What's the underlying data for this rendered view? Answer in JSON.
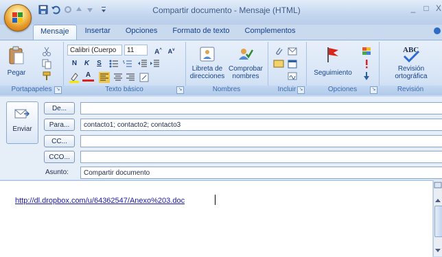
{
  "window": {
    "title": "Compartir documento - Mensaje (HTML)",
    "minimize_glyph": "_",
    "maximize_glyph": "□",
    "close_glyph": "X"
  },
  "tabs": [
    {
      "label": "Mensaje",
      "active": true
    },
    {
      "label": "Insertar"
    },
    {
      "label": "Opciones"
    },
    {
      "label": "Formato de texto"
    },
    {
      "label": "Complementos"
    }
  ],
  "ribbon": {
    "portapapeles": {
      "label": "Portapapeles",
      "paste": "Pegar"
    },
    "texto_basico": {
      "label": "Texto básico",
      "font": "Calibri (Cuerpo",
      "size": "11",
      "bold": "N",
      "italic": "K",
      "underline": "S"
    },
    "nombres": {
      "label": "Nombres",
      "address_book": "Libreta de direcciones",
      "check_names": "Comprobar nombres"
    },
    "incluir": {
      "label": "Incluir"
    },
    "opciones": {
      "label": "Opciones",
      "follow_up": "Seguimiento"
    },
    "revision": {
      "label": "Revisión",
      "spelling": "Revisión ortográfica"
    }
  },
  "header": {
    "send": "Enviar",
    "from_btn": "De...",
    "to_btn": "Para...",
    "cc_btn": "CC...",
    "bcc_btn": "CCO...",
    "from_value": "",
    "to_value": "contacto1; contacto2; contacto3",
    "cc_value": "",
    "bcc_value": "",
    "subject_label": "Asunto:",
    "subject_value": "Compartir documento"
  },
  "body": {
    "link": "http://dl.dropbox.com/u/64362547/Anexo%203.doc"
  },
  "colors": {
    "accent": "#15428b",
    "ribbon_bg": "#d9e6f7",
    "link": "#1a1aa6"
  }
}
